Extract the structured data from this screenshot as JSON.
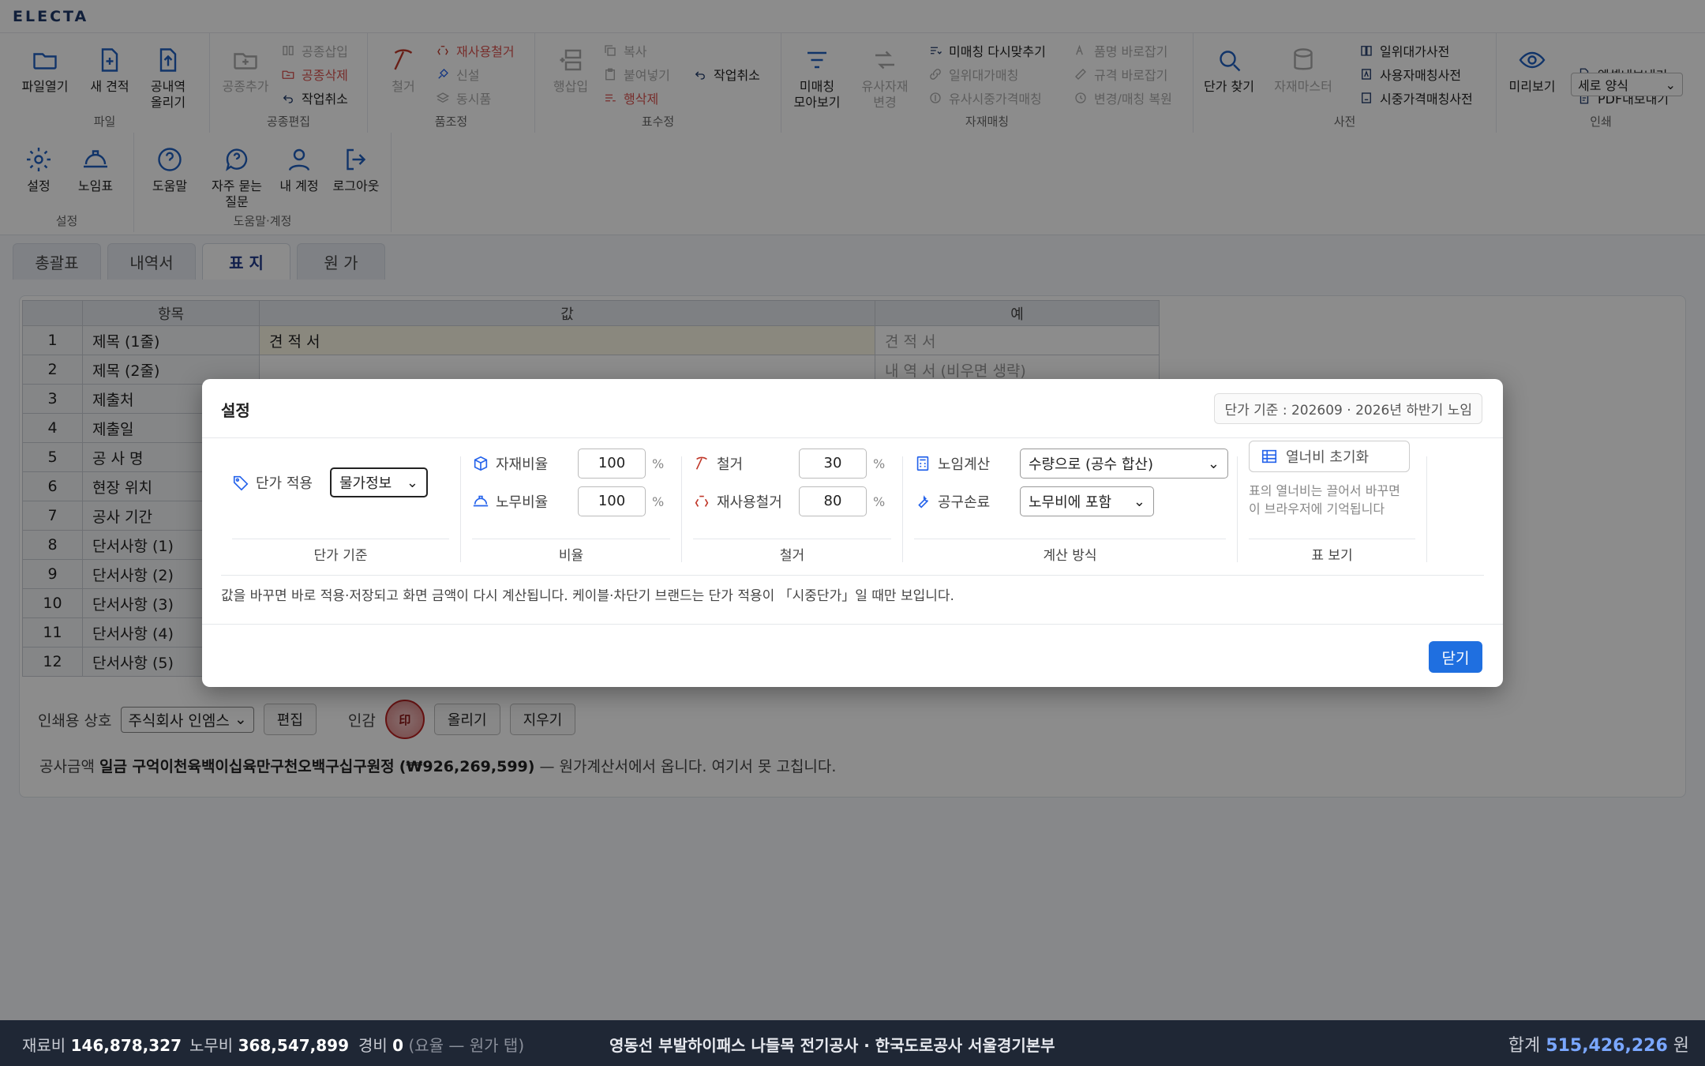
{
  "app": {
    "logo": "ELECTA"
  },
  "ribbon": {
    "file": {
      "label": "파일",
      "open": "파일열기",
      "new": "새 견적",
      "upload_1": "공내역",
      "upload_2": "올리기"
    },
    "trade": {
      "label": "공종편집",
      "add": "공종추가",
      "insert": "공종삽입",
      "delete": "공종삭제",
      "undo": "작업취소"
    },
    "item": {
      "label": "품조정",
      "demolish": "철거",
      "reuse": "재사용철거",
      "new": "신설",
      "same": "동시품"
    },
    "table": {
      "label": "표수정",
      "row_insert": "행삽입",
      "copy": "복사",
      "paste": "붙여넣기",
      "row_delete": "행삭제",
      "undo": "작업취소"
    },
    "material": {
      "label": "자재매칭",
      "unmatched_1": "미매칭",
      "unmatched_2": "모아보기",
      "similar_1": "유사자재",
      "similar_2": "변경",
      "rematch": "미매칭 다시맞추기",
      "unit_price_match": "일위대가매칭",
      "similar_price": "유사시중가격매칭",
      "name_fix": "품명 바로잡기",
      "spec_fix": "규격 바로잡기",
      "restore": "변경/매칭 복원"
    },
    "dict": {
      "label": "사전",
      "find": "단가 찾기",
      "master": "자재마스터",
      "unit_dict": "일위대가사전",
      "material_dict": "사용자매칭사전",
      "market_dict": "시중가격매칭사전"
    },
    "print": {
      "label": "인쇄",
      "preview": "미리보기",
      "view_mode": "세로 양식",
      "excel": "엑셀내보내기",
      "pdf": "PDF내보내기"
    },
    "settings": {
      "label": "설정",
      "settings": "설정",
      "labor": "노임표"
    },
    "help": {
      "label": "도움말·계정",
      "help": "도움말",
      "faq_1": "자주 묻는",
      "faq_2": "질문",
      "account": "내 계정",
      "logout": "로그아웃"
    }
  },
  "tabs": [
    {
      "label": "총괄표"
    },
    {
      "label": "내역서"
    },
    {
      "label": "표 지"
    },
    {
      "label": "원 가"
    }
  ],
  "cover": {
    "headers": {
      "item": "항목",
      "value": "값",
      "example": "예"
    },
    "rows": [
      {
        "no": "1",
        "key": "제목 (1줄)",
        "value": "견 적 서",
        "example": "견 적 서"
      },
      {
        "no": "2",
        "key": "제목 (2줄)",
        "value": "",
        "example": "내 역 서 (비우면 생략)"
      },
      {
        "no": "3",
        "key": "제출처",
        "value": "",
        "example": ""
      },
      {
        "no": "4",
        "key": "제출일",
        "value": "",
        "example": ""
      },
      {
        "no": "5",
        "key": "공 사 명",
        "value": "",
        "example": ""
      },
      {
        "no": "6",
        "key": "현장 위치",
        "value": "",
        "example": ""
      },
      {
        "no": "7",
        "key": "공사 기간",
        "value": "",
        "example": ""
      },
      {
        "no": "8",
        "key": "단서사항 (1)",
        "value": "",
        "example": ""
      },
      {
        "no": "9",
        "key": "단서사항 (2)",
        "value": "",
        "example": ""
      },
      {
        "no": "10",
        "key": "단서사항 (3)",
        "value": "",
        "example": ""
      },
      {
        "no": "11",
        "key": "단서사항 (4)",
        "value": "",
        "example": ""
      },
      {
        "no": "12",
        "key": "단서사항 (5)",
        "value": "",
        "example": ""
      }
    ],
    "company_label": "인쇄용 상호",
    "company_value": "주식회사 인엠스",
    "edit": "편집",
    "seal_label": "인감",
    "upload": "올리기",
    "remove": "지우기",
    "amount_prefix": "공사금액",
    "amount_words": "일금 구억이천육백이십육만구천오백구십구원정",
    "amount_num": "(₩926,269,599)",
    "amount_suffix": "— 원가계산서에서 옵니다. 여기서 못 고칩니다."
  },
  "modal": {
    "title": "설정",
    "basis": "단가 기준 : 202609 · 2026년 하반기 노임",
    "price_apply_label": "단가 적용",
    "price_apply_value": "물가정보",
    "sec_price": "단가 기준",
    "material_ratio_label": "자재비율",
    "material_ratio": "100",
    "labor_ratio_label": "노무비율",
    "labor_ratio": "100",
    "sec_ratio": "비율",
    "demolish_label": "철거",
    "demolish": "30",
    "reuse_label": "재사용철거",
    "reuse": "80",
    "sec_demolish": "철거",
    "labor_calc_label": "노임계산",
    "labor_calc": "수량으로 (공수 합산)",
    "tool_label": "공구손료",
    "tool": "노무비에 포함",
    "sec_calc": "계산 방식",
    "reset_cols": "열너비 초기화",
    "reset_hint": "표의 열너비는 끌어서 바꾸면 이 브라우저에 기억됩니다",
    "sec_view": "표 보기",
    "percent": "%",
    "note": "값을 바꾸면 바로 적용·저장되고 화면 금액이 다시 계산됩니다. 케이블·차단기 브랜드는 단가 적용이 「시중단가」일 때만 보입니다.",
    "close": "닫기"
  },
  "status": {
    "material_label": "재료비",
    "material": "146,878,327",
    "labor_label": "노무비",
    "labor": "368,547,899",
    "expense_label": "경비",
    "expense": "0",
    "expense_note": "(요율 — 원가 탭)",
    "project": "영동선 부발하이패스 나들목 전기공사 · 한국도로공사 서울경기본부",
    "total_label": "합계",
    "total": "515,426,226",
    "unit": "원"
  },
  "colors": {
    "accent": "#1f6fe0",
    "brand": "#1f3a6a",
    "statusbar": "#1f2735"
  }
}
